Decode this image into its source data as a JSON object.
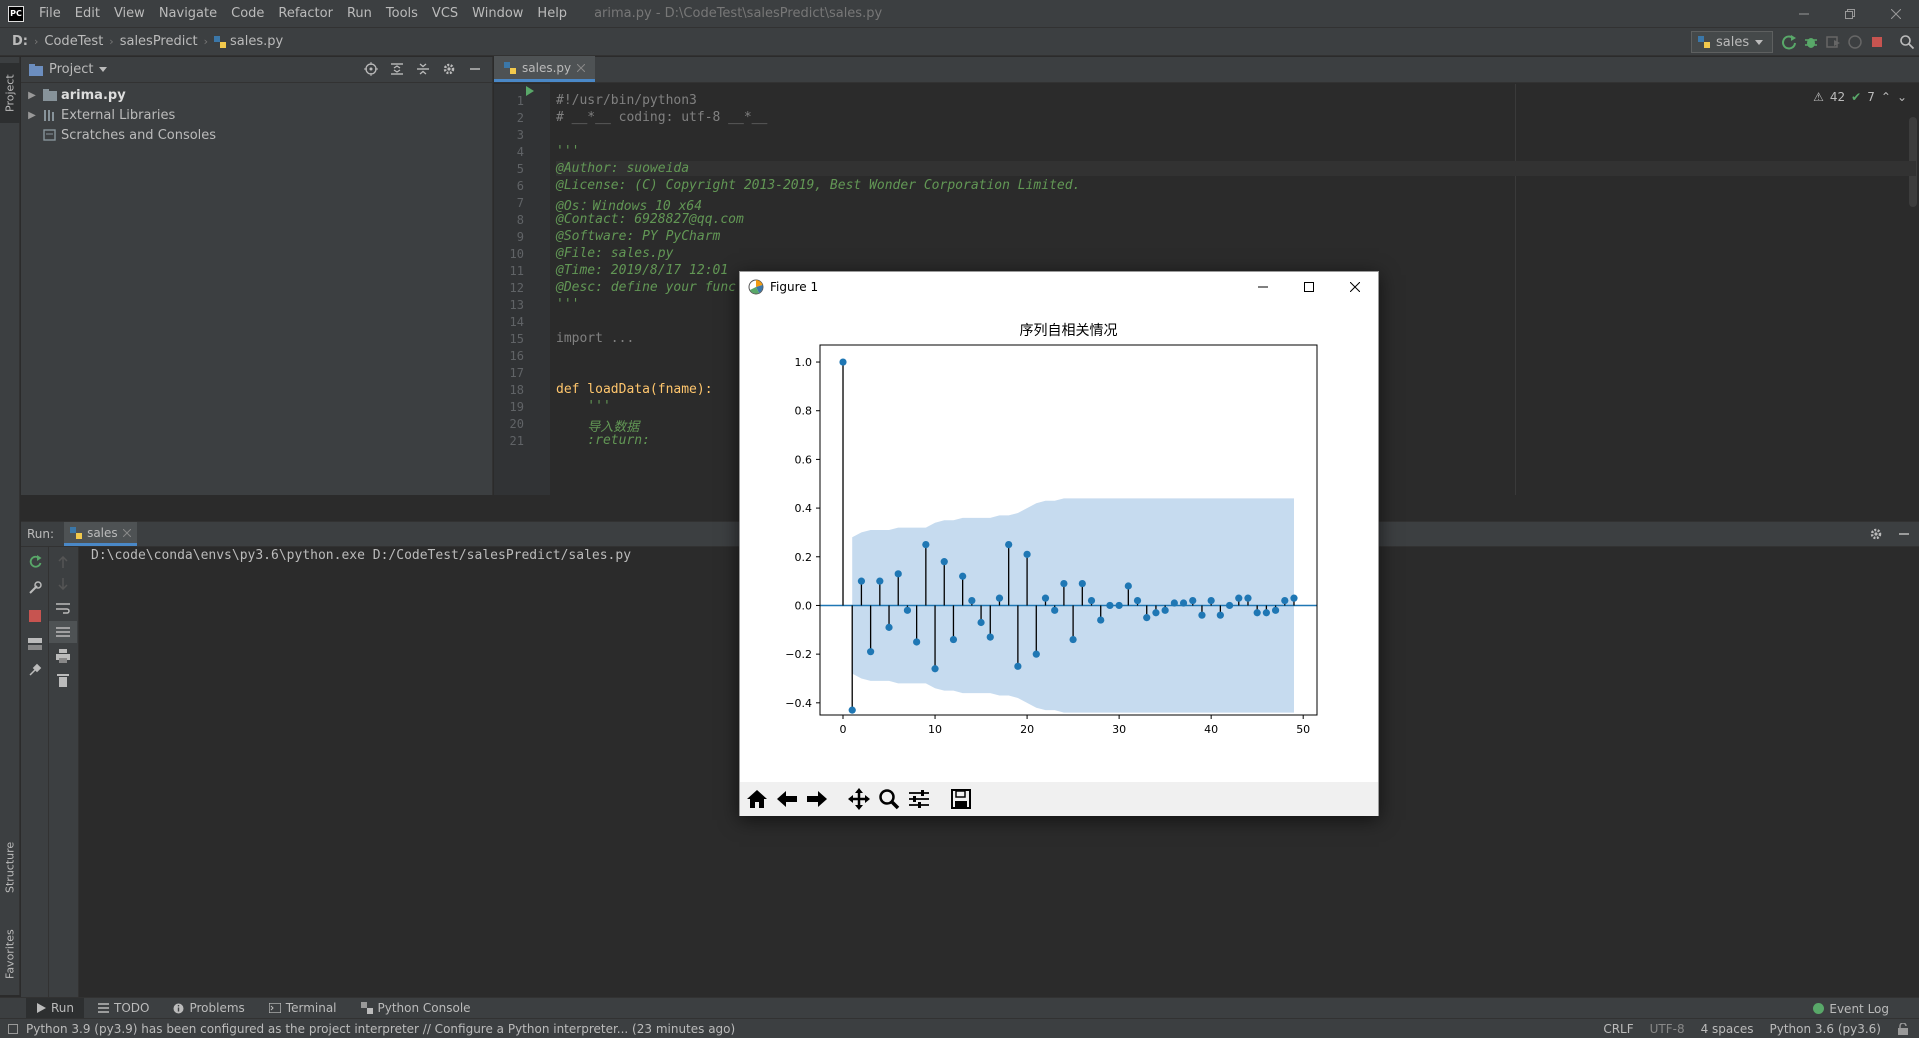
{
  "menubar": {
    "logo_text": "PC",
    "items": [
      "File",
      "Edit",
      "View",
      "Navigate",
      "Code",
      "Refactor",
      "Run",
      "Tools",
      "VCS",
      "Window",
      "Help"
    ],
    "window_title": "arima.py - D:\\CodeTest\\salesPredict\\sales.py"
  },
  "navbar": {
    "breadcrumbs": [
      "D:",
      "CodeTest",
      "salesPredict",
      "sales.py"
    ],
    "run_config": "sales"
  },
  "left_stripe": {
    "project_tab": "Project",
    "structure_tab": "Structure",
    "favorites_tab": "Favorites"
  },
  "project": {
    "title": "Project",
    "tree": [
      {
        "label": "arima.py",
        "bold": true
      },
      {
        "label": "External Libraries",
        "bold": false
      },
      {
        "label": "Scratches and Consoles",
        "bold": false
      }
    ]
  },
  "editor": {
    "tab": "sales.py",
    "inspections": {
      "warnings": "42",
      "weak": "7"
    },
    "lines": [
      {
        "n": "1",
        "text": "#!/usr/bin/python3",
        "cls": "c-comment"
      },
      {
        "n": "2",
        "text": "# __*__ coding: utf-8 __*__",
        "cls": "c-comment"
      },
      {
        "n": "3",
        "text": "",
        "cls": "c-plain"
      },
      {
        "n": "4",
        "text": "'''",
        "cls": "c-doc"
      },
      {
        "n": "5",
        "text": "@Author: suoweida",
        "cls": "c-doc"
      },
      {
        "n": "6",
        "text": "@License: (C) Copyright 2013-2019, Best Wonder Corporation Limited.",
        "cls": "c-doc"
      },
      {
        "n": "7",
        "text": "@Os：Windows 10 x64",
        "cls": "c-doc"
      },
      {
        "n": "8",
        "text": "@Contact: 6928827@qq.com",
        "cls": "c-doc"
      },
      {
        "n": "9",
        "text": "@Software: PY PyCharm",
        "cls": "c-doc"
      },
      {
        "n": "10",
        "text": "@File: sales.py",
        "cls": "c-doc"
      },
      {
        "n": "11",
        "text": "@Time: 2019/8/17 12:01",
        "cls": "c-doc"
      },
      {
        "n": "12",
        "text": "@Desc: define your func",
        "cls": "c-doc"
      },
      {
        "n": "13",
        "text": "'''",
        "cls": "c-doc"
      },
      {
        "n": "14",
        "text": "",
        "cls": "c-plain"
      },
      {
        "n": "15",
        "text": "import ...",
        "cls": "c-comment"
      },
      {
        "n": "16",
        "text": "",
        "cls": "c-plain"
      },
      {
        "n": "17",
        "text": "",
        "cls": "c-plain"
      },
      {
        "n": "18",
        "text": "def loadData(fname):",
        "cls": "c-fn"
      },
      {
        "n": "19",
        "text": "    '''",
        "cls": "c-doc"
      },
      {
        "n": "20",
        "text": "    导入数据",
        "cls": "c-doc"
      },
      {
        "n": "21",
        "text": "    :return:",
        "cls": "c-doc"
      }
    ]
  },
  "run": {
    "label": "Run:",
    "tab": "sales",
    "command": "D:\\code\\conda\\envs\\py3.6\\python.exe D:/CodeTest/salesPredict/sales.py"
  },
  "bottom_tabs": [
    "Run",
    "TODO",
    "Problems",
    "Terminal",
    "Python Console"
  ],
  "event_log": "Event Log",
  "status": {
    "message": "Python 3.9 (py3.9) has been configured as the project interpreter // Configure a Python interpreter... (23 minutes ago)",
    "crlf": "CRLF",
    "encoding": "UTF-8",
    "indent": "4 spaces",
    "interpreter": "Python 3.6 (py3.6)"
  },
  "figure": {
    "window_title": "Figure 1",
    "chart_data": {
      "type": "stem",
      "title": "序列自相关情况",
      "xlim": [
        -2.5,
        51.5
      ],
      "ylim": [
        -0.45,
        1.07
      ],
      "xticks": [
        0,
        10,
        20,
        30,
        40,
        50
      ],
      "yticks": [
        1.0,
        0.8,
        0.6,
        0.4,
        0.2,
        0.0,
        -0.2,
        -0.4
      ],
      "ytick_labels": [
        "1.0",
        "0.8",
        "0.6",
        "0.4",
        "0.2",
        "0.0",
        "−0.2",
        "−0.4"
      ],
      "x": [
        0,
        1,
        2,
        3,
        4,
        5,
        6,
        7,
        8,
        9,
        10,
        11,
        12,
        13,
        14,
        15,
        16,
        17,
        18,
        19,
        20,
        21,
        22,
        23,
        24,
        25,
        26,
        27,
        28,
        29,
        30,
        31,
        32,
        33,
        34,
        35,
        36,
        37,
        38,
        39,
        40,
        41,
        42,
        43,
        44,
        45,
        46,
        47,
        48,
        49
      ],
      "values": [
        1.0,
        -0.43,
        0.1,
        -0.19,
        0.1,
        -0.09,
        0.13,
        -0.02,
        -0.15,
        0.25,
        -0.26,
        0.18,
        -0.14,
        0.12,
        0.02,
        -0.07,
        -0.13,
        0.03,
        0.25,
        -0.25,
        0.21,
        -0.2,
        0.03,
        -0.02,
        0.09,
        -0.14,
        0.09,
        0.02,
        -0.06,
        0.0,
        0.0,
        0.08,
        0.02,
        -0.05,
        -0.03,
        -0.02,
        0.01,
        0.01,
        0.02,
        -0.04,
        0.02,
        -0.04,
        0.0,
        0.03,
        0.03,
        -0.03,
        -0.03,
        -0.02,
        0.02,
        0.03
      ],
      "confidence_upper": [
        0.0,
        0.28,
        0.3,
        0.31,
        0.31,
        0.31,
        0.32,
        0.32,
        0.32,
        0.32,
        0.34,
        0.35,
        0.35,
        0.36,
        0.36,
        0.36,
        0.36,
        0.37,
        0.37,
        0.38,
        0.4,
        0.42,
        0.43,
        0.43,
        0.44,
        0.44,
        0.44,
        0.44,
        0.44,
        0.44,
        0.44,
        0.44,
        0.44,
        0.44,
        0.44,
        0.44,
        0.44,
        0.44,
        0.44,
        0.44,
        0.44,
        0.44,
        0.44,
        0.44,
        0.44,
        0.44,
        0.44,
        0.44,
        0.44,
        0.44
      ],
      "colors": {
        "stem": "#000000",
        "marker": "#1f77b4",
        "band": "#c6dbef",
        "baseline": "#1f77b4"
      }
    },
    "toolbar": [
      "home-icon",
      "back-arrow-icon",
      "forward-arrow-icon",
      "pan-icon",
      "zoom-icon",
      "configure-subplots-icon",
      "save-icon"
    ]
  }
}
